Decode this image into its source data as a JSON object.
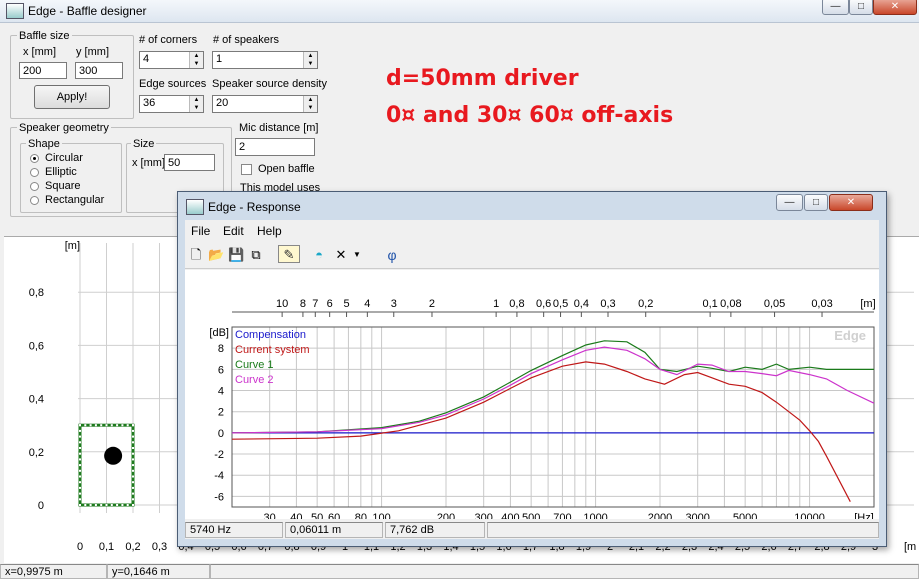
{
  "main_window": {
    "title": "Edge - Baffle designer",
    "controls": [
      "—",
      "□",
      "✕"
    ]
  },
  "baffle_size": {
    "group_label": "Baffle size",
    "x_label": "x [mm]",
    "y_label": "y [mm]",
    "x_value": "200",
    "y_value": "300",
    "apply_label": "Apply!"
  },
  "corners": {
    "label": "# of corners",
    "value": "4"
  },
  "speakers": {
    "label": "# of speakers",
    "value": "1"
  },
  "edge_sources": {
    "label": "Edge sources",
    "value": "36"
  },
  "speaker_density": {
    "label": "Speaker source density",
    "value": "20"
  },
  "speaker_geometry": {
    "group_label": "Speaker geometry",
    "shape_label": "Shape",
    "shapes": [
      "Circular",
      "Elliptic",
      "Square",
      "Rectangular"
    ],
    "selected_shape": "Circular",
    "size_label": "Size",
    "size_x_label": "x [mm]",
    "size_x_value": "50"
  },
  "mic_distance": {
    "label": "Mic distance [m]",
    "value": "2"
  },
  "open_baffle": {
    "label": "Open baffle",
    "checked": false
  },
  "model_note": "This model uses",
  "annotation": {
    "line1": "d=50mm driver",
    "line2": "0¤ and 30¤ 60¤ off-axis"
  },
  "baffle_plot": {
    "unit_label": "[m]",
    "y_ticks": [
      "0,8",
      "0,6",
      "0,4",
      "0,2",
      "0"
    ],
    "x_ticks": [
      "0",
      "0,1",
      "0,2",
      "0,3",
      "0,4",
      "0,5",
      "0,6",
      "0,7",
      "0,8",
      "0,9",
      "1",
      "1,1",
      "1,2",
      "1,3",
      "1,4",
      "1,5",
      "1,6",
      "1,7",
      "1,8",
      "1,9",
      "2",
      "2,1",
      "2,2",
      "2,3",
      "2,4",
      "2,5",
      "2,6",
      "2,7",
      "2,8",
      "2,9",
      "3"
    ],
    "x_unit": "[m",
    "baffle_color": "#1e7a1e"
  },
  "status_bar": {
    "x": "x=0,9975 m",
    "y": "y=0,1646 m"
  },
  "response_window": {
    "title": "Edge - Response",
    "menu": [
      "File",
      "Edit",
      "Help"
    ],
    "toolbar_icons": [
      "new-icon",
      "open-icon",
      "save-icon",
      "copy-icon",
      "pen-icon",
      "dome-icon",
      "delete-icon",
      "dropdown-icon",
      "phi-icon"
    ],
    "phi_label": "φ",
    "status": {
      "freq": "5740 Hz",
      "distance": "0,06011 m",
      "level": "7,762 dB"
    }
  },
  "chart_data": {
    "type": "line",
    "watermark": "Edge",
    "ylabel": "[dB]",
    "xlabel": "[Hz]",
    "top_axis_unit": "[m]",
    "x_scale": "log",
    "xlim": [
      20,
      20000
    ],
    "ylim": [
      -7,
      10
    ],
    "y_ticks": [
      8,
      6,
      4,
      2,
      0,
      -2,
      -4,
      -6
    ],
    "x_ticks": [
      30,
      40,
      50,
      60,
      80,
      100,
      200,
      300,
      400,
      500,
      700,
      1000,
      2000,
      3000,
      5000,
      10000
    ],
    "x_tick_labels": [
      "30",
      "40",
      "50",
      "60",
      "80",
      "100",
      "200",
      "300",
      "400",
      "500",
      "700",
      "1000",
      "2000",
      "3000",
      "5000",
      "10000"
    ],
    "top_ticks": [
      {
        "label": "10",
        "hz": 34.3
      },
      {
        "label": "8",
        "hz": 42.9
      },
      {
        "label": "7",
        "hz": 49.0
      },
      {
        "label": "6",
        "hz": 57.2
      },
      {
        "label": "5",
        "hz": 68.6
      },
      {
        "label": "4",
        "hz": 85.8
      },
      {
        "label": "3",
        "hz": 114
      },
      {
        "label": "2",
        "hz": 172
      },
      {
        "label": "1",
        "hz": 343
      },
      {
        "label": "0,8",
        "hz": 429
      },
      {
        "label": "0,6",
        "hz": 572
      },
      {
        "label": "0,5",
        "hz": 686
      },
      {
        "label": "0,4",
        "hz": 858
      },
      {
        "label": "0,3",
        "hz": 1143
      },
      {
        "label": "0,2",
        "hz": 1715
      },
      {
        "label": "0,1",
        "hz": 3430
      },
      {
        "label": "0,08",
        "hz": 4288
      },
      {
        "label": "0,05",
        "hz": 6860
      },
      {
        "label": "0,03",
        "hz": 11433
      }
    ],
    "legend_position": "top-left",
    "grid": true,
    "series": [
      {
        "name": "Compensation",
        "color": "#1a1acc",
        "points": [
          [
            20,
            0
          ],
          [
            20000,
            0
          ]
        ]
      },
      {
        "name": "Current system",
        "color": "#c01818",
        "points": [
          [
            20,
            -0.6
          ],
          [
            50,
            -0.5
          ],
          [
            80,
            -0.3
          ],
          [
            120,
            0.2
          ],
          [
            200,
            1.4
          ],
          [
            300,
            2.9
          ],
          [
            400,
            4.2
          ],
          [
            500,
            5.2
          ],
          [
            700,
            6.3
          ],
          [
            900,
            6.7
          ],
          [
            1100,
            6.5
          ],
          [
            1400,
            5.8
          ],
          [
            1700,
            5.1
          ],
          [
            2100,
            4.6
          ],
          [
            2600,
            5.5
          ],
          [
            3000,
            5.7
          ],
          [
            3500,
            5.2
          ],
          [
            4200,
            4.6
          ],
          [
            5000,
            4.4
          ],
          [
            6000,
            3.8
          ],
          [
            7000,
            2.9
          ],
          [
            8000,
            2.0
          ],
          [
            9000,
            1.2
          ],
          [
            10000,
            0.2
          ],
          [
            11000,
            -0.8
          ],
          [
            12000,
            -2.2
          ],
          [
            14000,
            -4.8
          ],
          [
            15500,
            -6.5
          ]
        ]
      },
      {
        "name": "Curve 1",
        "color": "#1a7a1a",
        "points": [
          [
            20,
            0
          ],
          [
            50,
            0.1
          ],
          [
            100,
            0.5
          ],
          [
            150,
            1.1
          ],
          [
            200,
            1.9
          ],
          [
            300,
            3.4
          ],
          [
            400,
            4.8
          ],
          [
            500,
            5.9
          ],
          [
            700,
            7.3
          ],
          [
            900,
            8.3
          ],
          [
            1100,
            8.7
          ],
          [
            1400,
            8.6
          ],
          [
            1700,
            7.6
          ],
          [
            2000,
            6.0
          ],
          [
            2400,
            5.8
          ],
          [
            3000,
            6.3
          ],
          [
            3500,
            6.1
          ],
          [
            4200,
            5.8
          ],
          [
            5000,
            6.2
          ],
          [
            6000,
            6.0
          ],
          [
            7000,
            6.5
          ],
          [
            8000,
            6.0
          ],
          [
            10000,
            6.2
          ],
          [
            12000,
            6.0
          ],
          [
            15000,
            6.0
          ],
          [
            20000,
            6.0
          ]
        ]
      },
      {
        "name": "Curve 2",
        "color": "#cc33cc",
        "points": [
          [
            20,
            0
          ],
          [
            50,
            0.1
          ],
          [
            100,
            0.4
          ],
          [
            150,
            1.0
          ],
          [
            200,
            1.7
          ],
          [
            300,
            3.2
          ],
          [
            400,
            4.5
          ],
          [
            500,
            5.6
          ],
          [
            700,
            6.9
          ],
          [
            900,
            7.8
          ],
          [
            1100,
            8.1
          ],
          [
            1400,
            7.8
          ],
          [
            1700,
            7.0
          ],
          [
            2000,
            6.0
          ],
          [
            2400,
            5.5
          ],
          [
            3000,
            6.5
          ],
          [
            3500,
            6.4
          ],
          [
            4200,
            5.8
          ],
          [
            5000,
            5.8
          ],
          [
            6000,
            5.6
          ],
          [
            7000,
            5.4
          ],
          [
            8000,
            5.9
          ],
          [
            10000,
            5.5
          ],
          [
            12000,
            5.1
          ],
          [
            15000,
            4.0
          ],
          [
            20000,
            2.8
          ]
        ]
      }
    ]
  }
}
